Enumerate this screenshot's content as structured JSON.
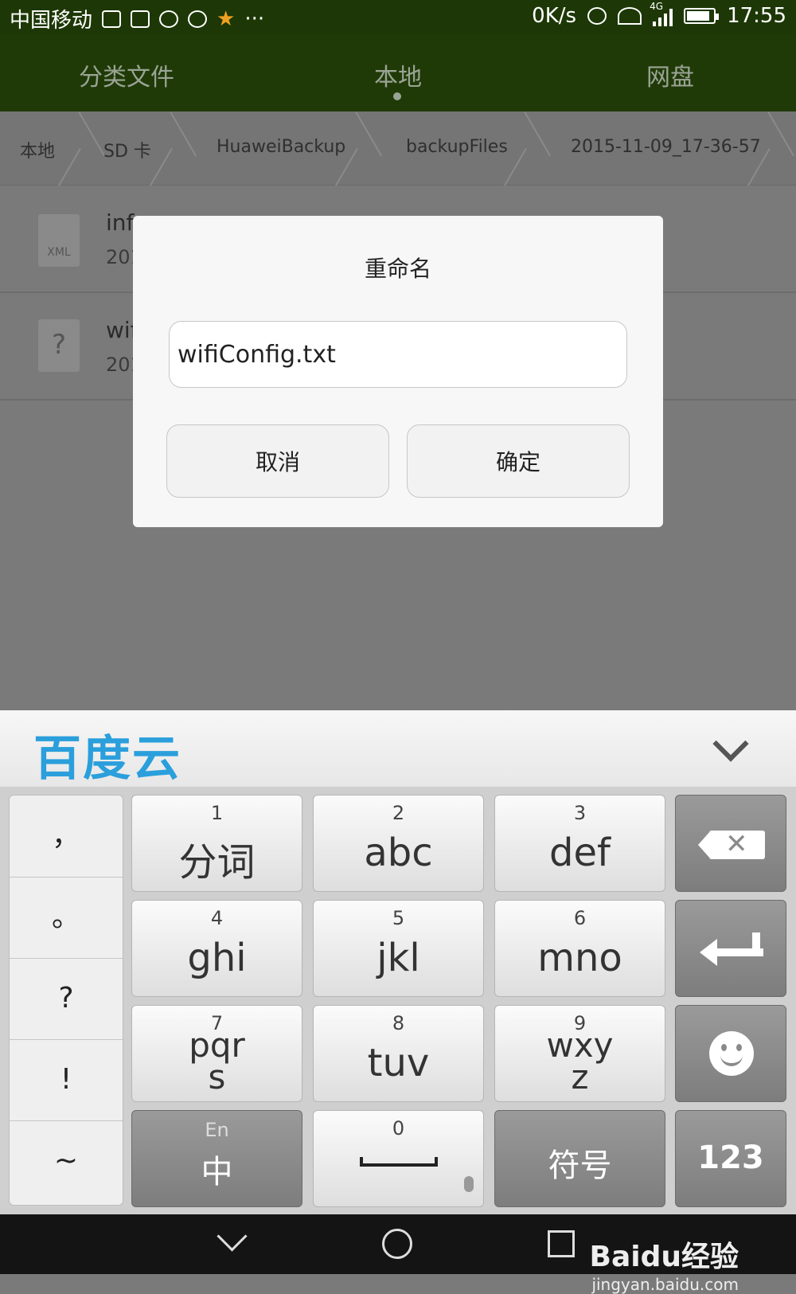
{
  "status_bar": {
    "carrier": "中国移动",
    "more": "···",
    "speed": "0K/s",
    "network": "4G",
    "time": "17:55"
  },
  "tabs": [
    {
      "label": "分类文件"
    },
    {
      "label": "本地"
    },
    {
      "label": "网盘"
    }
  ],
  "breadcrumb": [
    "本地",
    "SD 卡",
    "HuaweiBackup",
    "backupFiles",
    "2015-11-09_17-36-57"
  ],
  "files": [
    {
      "icon_label": "XML",
      "name": "inf",
      "date": "201"
    },
    {
      "icon_label": "?",
      "name": "wif",
      "date": "201"
    }
  ],
  "dialog": {
    "title": "重命名",
    "input_value": "wifiConfig.txt",
    "cancel_label": "取消",
    "confirm_label": "确定"
  },
  "keyboard": {
    "brand": "百度云",
    "punctuation": [
      "，",
      "。",
      "?",
      "!",
      "~"
    ],
    "keys": [
      {
        "num": "1",
        "label": "分词"
      },
      {
        "num": "2",
        "label": "abc"
      },
      {
        "num": "3",
        "label": "def"
      },
      {
        "num": "4",
        "label": "ghi"
      },
      {
        "num": "5",
        "label": "jkl"
      },
      {
        "num": "6",
        "label": "mno"
      },
      {
        "num": "7",
        "label": "pqr",
        "label2": "s"
      },
      {
        "num": "8",
        "label": "tuv"
      },
      {
        "num": "9",
        "label": "wxy",
        "label2": "z"
      }
    ],
    "lang_top": "En",
    "lang_bottom": "中",
    "space_num": "0",
    "symbols_label": "符号",
    "numbers_label": "123"
  },
  "watermark": {
    "brand": "Baidu经验",
    "url": "jingyan.baidu.com"
  }
}
